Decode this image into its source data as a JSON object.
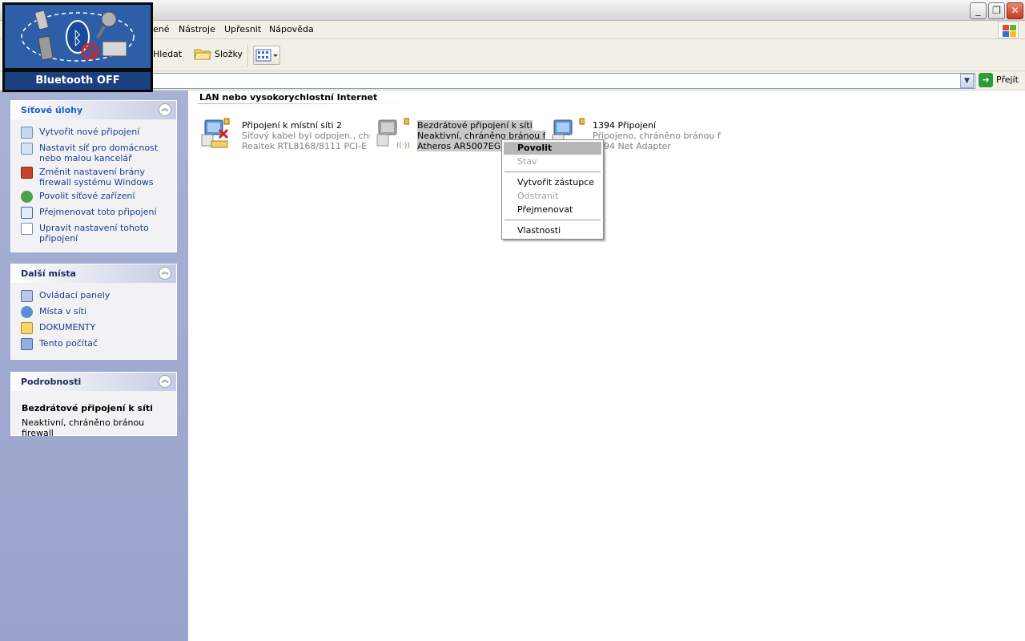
{
  "menu": {
    "items": [
      "ené",
      "Nástroje",
      "Upřesnit",
      "Nápověda"
    ]
  },
  "toolbar": {
    "search_label": "Hledat",
    "folders_label": "Složky"
  },
  "address": {
    "go_label": "Přejít"
  },
  "sidebar": {
    "network_tasks": {
      "title": "Síťové úlohy",
      "items": [
        {
          "label": "Vytvořit nové připojení",
          "icon": "new-connection-icon"
        },
        {
          "label": "Nastavit síť pro domácnost nebo malou kancelář",
          "icon": "home-network-icon"
        },
        {
          "label": "Změnit nastavení brány firewall systému Windows",
          "icon": "firewall-icon"
        },
        {
          "label": "Povolit síťové zařízení",
          "icon": "enable-device-icon"
        },
        {
          "label": "Přejmenovat toto připojení",
          "icon": "rename-icon"
        },
        {
          "label": "Upravit nastavení tohoto připojení",
          "icon": "properties-icon"
        }
      ]
    },
    "other_places": {
      "title": "Další místa",
      "items": [
        {
          "label": "Ovládací panely",
          "icon": "control-panel-icon"
        },
        {
          "label": "Místa v síti",
          "icon": "network-places-icon"
        },
        {
          "label": "DOKUMENTY",
          "icon": "documents-icon"
        },
        {
          "label": "Tento počítač",
          "icon": "my-computer-icon"
        }
      ]
    },
    "details": {
      "title": "Podrobnosti",
      "name": "Bezdrátové připojení k síti",
      "status": "Neaktivní, chráněno bránou firewall"
    }
  },
  "main": {
    "group_title": "LAN nebo vysokorychlostní Internet",
    "connections": [
      {
        "name": "Připojení k místní síti 2",
        "status": "Síťový kabel byl odpojen., chr...",
        "device": "Realtek RTL8168/8111 PCI-E ..."
      },
      {
        "name": "Bezdrátové připojení k síti",
        "status": "Neaktivní, chráněno bránou fir...",
        "device": "Atheros AR5007EG W..."
      },
      {
        "name": "1394 Připojení",
        "status": "Připojeno, chráněno bránou fi...",
        "device": "1394 Net Adapter"
      }
    ]
  },
  "context_menu": {
    "enable": "Povolit",
    "status": "Stav",
    "create_shortcut": "Vytvořit zástupce",
    "delete": "Odstranit",
    "rename": "Přejmenovat",
    "properties": "Vlastnosti"
  },
  "bluetooth": {
    "label": "Bluetooth OFF"
  },
  "colors": {
    "sidebar_link": "#1a3d8f",
    "panel_title": "#215dc6",
    "bluetooth_bg": "#2f5ea8"
  }
}
